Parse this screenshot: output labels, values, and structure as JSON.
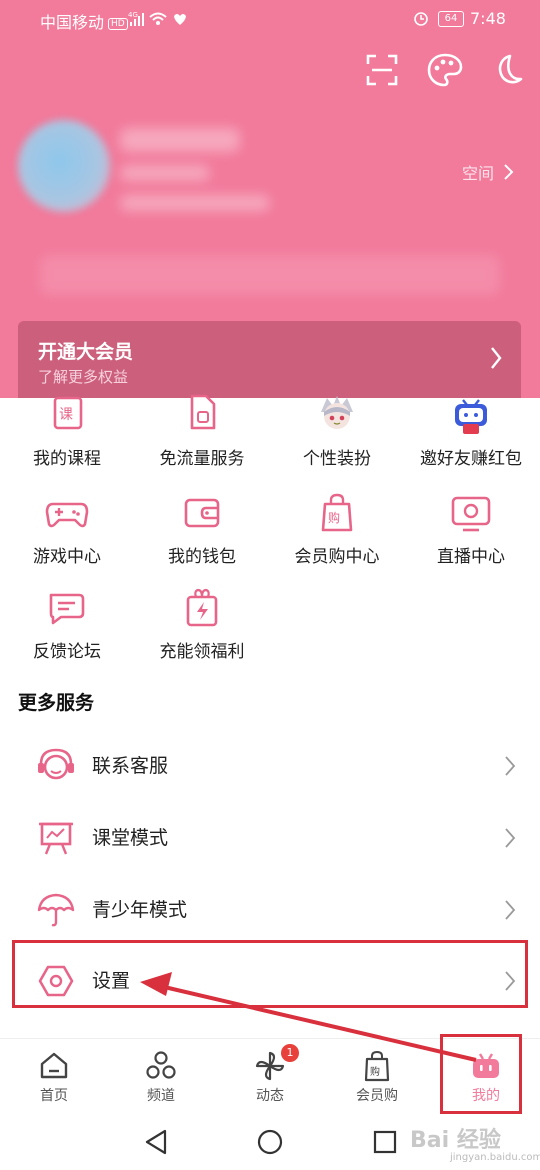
{
  "status_bar": {
    "carrier": "中国移动",
    "hd": "HD",
    "net": "4G",
    "battery": "64",
    "time": "7:48"
  },
  "header": {
    "space_link": "空间",
    "vip_title": "开通大会员",
    "vip_subtitle": "了解更多权益"
  },
  "grid": [
    {
      "label": "我的课程",
      "icon": "course-book-icon"
    },
    {
      "label": "免流量服务",
      "icon": "sim-card-icon"
    },
    {
      "label": "个性装扮",
      "icon": "anime-character-icon"
    },
    {
      "label": "邀好友赚红包",
      "icon": "tv-mascot-icon"
    },
    {
      "label": "游戏中心",
      "icon": "gamepad-icon"
    },
    {
      "label": "我的钱包",
      "icon": "wallet-icon"
    },
    {
      "label": "会员购中心",
      "icon": "shopping-bag-icon"
    },
    {
      "label": "直播中心",
      "icon": "live-tv-icon"
    },
    {
      "label": "反馈论坛",
      "icon": "chat-bubble-icon"
    },
    {
      "label": "充能领福利",
      "icon": "gift-lightning-icon"
    }
  ],
  "more_services": {
    "title": "更多服务",
    "items": [
      {
        "label": "联系客服",
        "icon": "headset-icon"
      },
      {
        "label": "课堂模式",
        "icon": "presentation-board-icon"
      },
      {
        "label": "青少年模式",
        "icon": "umbrella-icon"
      },
      {
        "label": "设置",
        "icon": "settings-hexagon-icon"
      }
    ]
  },
  "tabbar": [
    {
      "label": "首页",
      "icon": "home-icon"
    },
    {
      "label": "频道",
      "icon": "channels-icon"
    },
    {
      "label": "动态",
      "icon": "pinwheel-icon",
      "badge": "1"
    },
    {
      "label": "会员购",
      "icon": "shopping-bag-icon"
    },
    {
      "label": "我的",
      "icon": "bilibili-tv-icon"
    }
  ],
  "watermark": {
    "text": "Bai 经验",
    "sub": "jingyan.baidu.com"
  },
  "colors": {
    "accent": "#f27a9b",
    "icon_pink": "#e8658a",
    "annotation_red": "#d9303d"
  }
}
